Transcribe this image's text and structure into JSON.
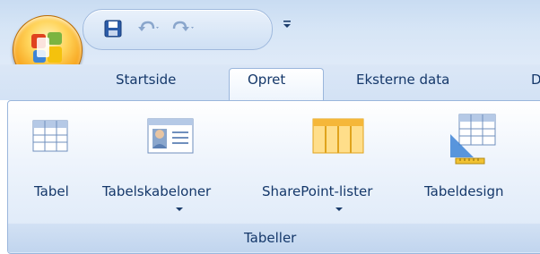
{
  "app": {
    "office_button_icon": "office-logo-icon",
    "quick_access": {
      "save_icon": "save-icon",
      "undo_icon": "undo-icon",
      "redo_icon": "redo-icon",
      "customize_icon": "customize-toolbar-icon"
    }
  },
  "tabs": [
    {
      "label": "Startside",
      "active": false
    },
    {
      "label": "Opret",
      "active": true
    },
    {
      "label": "Eksterne data",
      "active": false
    },
    {
      "label": "D",
      "active": false
    }
  ],
  "ribbon": {
    "groups": [
      {
        "label": "Tabeller",
        "commands": [
          {
            "label": "Tabel",
            "icon": "table-icon",
            "has_dropdown": false
          },
          {
            "label": "Tabelskabeloner",
            "icon": "table-templates-icon",
            "has_dropdown": true
          },
          {
            "label": "SharePoint-lister",
            "icon": "sharepoint-lists-icon",
            "has_dropdown": true
          },
          {
            "label": "Tabeldesign",
            "icon": "table-design-icon",
            "has_dropdown": false
          }
        ]
      }
    ]
  },
  "colors": {
    "text": "#15386a",
    "accent": "#f7a21b",
    "ribbon_border": "#9ab6dc"
  }
}
